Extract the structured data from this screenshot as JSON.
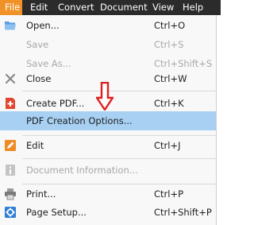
{
  "menubar": {
    "items": [
      {
        "label": "File",
        "active": true
      },
      {
        "label": "Edit",
        "active": false
      },
      {
        "label": "Convert",
        "active": false
      },
      {
        "label": "Document",
        "active": false
      },
      {
        "label": "View",
        "active": false
      },
      {
        "label": "Help",
        "active": false
      }
    ]
  },
  "file_menu": {
    "items": [
      {
        "label": "Open...",
        "shortcut": "Ctrl+O",
        "icon": "folder-open-icon",
        "enabled": true,
        "highlighted": false
      },
      {
        "label": "Save",
        "shortcut": "Ctrl+S",
        "icon": "",
        "enabled": false,
        "highlighted": false
      },
      {
        "label": "Save As...",
        "shortcut": "Ctrl+Shift+S",
        "icon": "",
        "enabled": false,
        "highlighted": false
      },
      {
        "label": "Close",
        "shortcut": "Ctrl+W",
        "icon": "close-x-icon",
        "enabled": true,
        "highlighted": false
      },
      {
        "label": "Create PDF...",
        "shortcut": "Ctrl+K",
        "icon": "create-pdf-icon",
        "enabled": true,
        "highlighted": false
      },
      {
        "label": "PDF Creation Options...",
        "shortcut": "",
        "icon": "",
        "enabled": true,
        "highlighted": true
      },
      {
        "label": "Edit",
        "shortcut": "Ctrl+J",
        "icon": "pencil-edit-icon",
        "enabled": true,
        "highlighted": false
      },
      {
        "label": "Document Information...",
        "shortcut": "",
        "icon": "info-icon",
        "enabled": false,
        "highlighted": false
      },
      {
        "label": "Print...",
        "shortcut": "Ctrl+P",
        "icon": "printer-icon",
        "enabled": true,
        "highlighted": false
      },
      {
        "label": "Page Setup...",
        "shortcut": "Ctrl+Shift+P",
        "icon": "page-setup-gear-icon",
        "enabled": true,
        "highlighted": false
      }
    ]
  },
  "annotation": {
    "icon": "red-down-arrow-icon",
    "color": "#e02020"
  },
  "colors": {
    "menubar_bg": "#2b2b2b",
    "active_menu": "#f09228",
    "highlight": "#a8d0f2",
    "disabled_text": "#a8a8a8"
  }
}
